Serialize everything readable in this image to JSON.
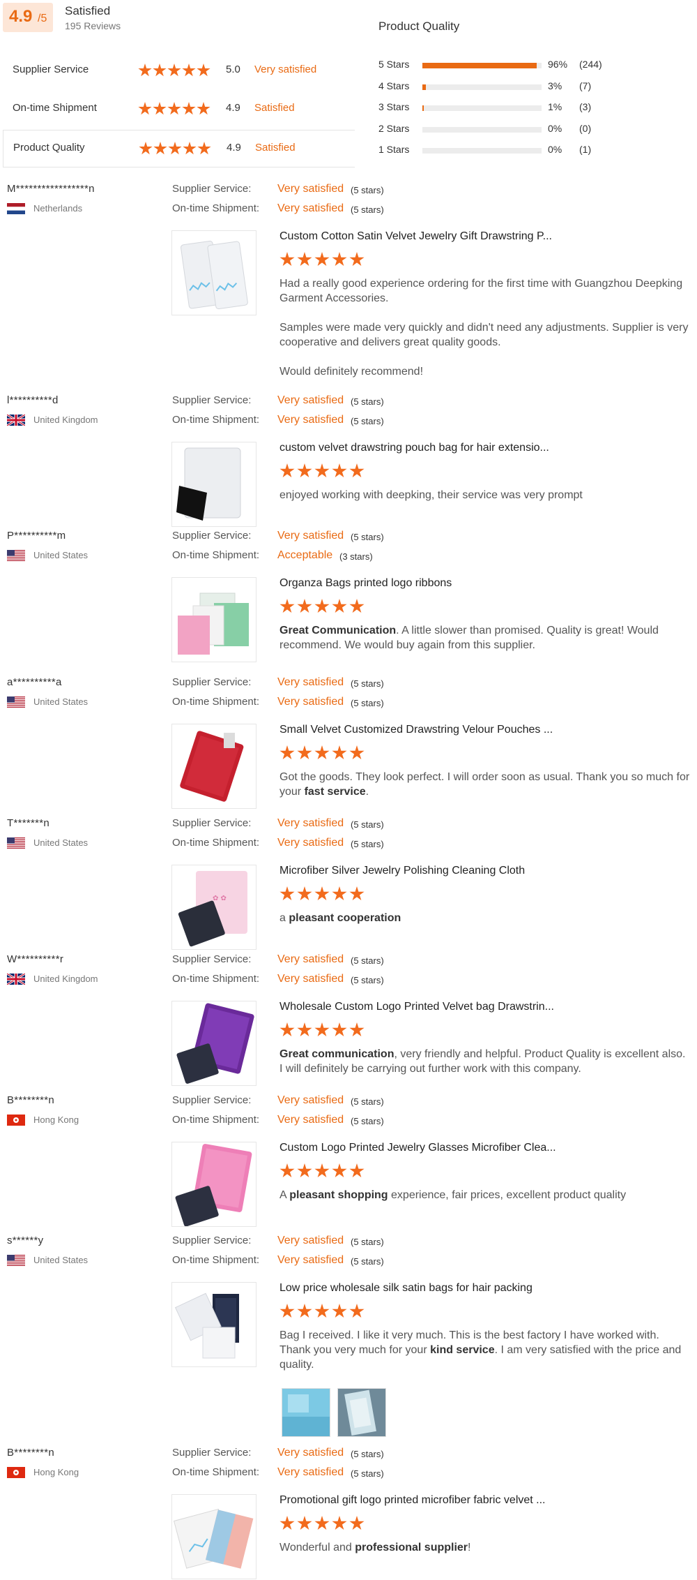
{
  "summary": {
    "score": "4.9",
    "score_max": "/5",
    "title": "Satisfied",
    "reviews": "195 Reviews",
    "rows": [
      {
        "label": "Supplier Service",
        "value": "5.0",
        "word": "Very satisfied"
      },
      {
        "label": "On-time Shipment",
        "value": "4.9",
        "word": "Satisfied"
      },
      {
        "label": "Product Quality",
        "value": "4.9",
        "word": "Satisfied"
      }
    ]
  },
  "product_quality": {
    "title": "Product Quality",
    "bars": [
      {
        "label": "5 Stars",
        "fraction": 0.96,
        "pct": "96%",
        "count": "(244)"
      },
      {
        "label": "4 Stars",
        "fraction": 0.03,
        "pct": "3%",
        "count": "(7)"
      },
      {
        "label": "3 Stars",
        "fraction": 0.01,
        "pct": "1%",
        "count": "(3)"
      },
      {
        "label": "2 Stars",
        "fraction": 0.0,
        "pct": "0%",
        "count": "(0)"
      },
      {
        "label": "1 Stars",
        "fraction": 0.0,
        "pct": "0%",
        "count": "(1)"
      }
    ]
  },
  "labels": {
    "supplier_service": "Supplier Service:",
    "ontime_shipment": "On-time Shipment:"
  },
  "reviews": [
    {
      "name": "M*****************n",
      "country": "Netherlands",
      "flag": "netherlands-flag-icon",
      "service": "Very satisfied",
      "service_stars": "(5 stars)",
      "shipment": "Very satisfied",
      "shipment_stars": "(5 stars)",
      "product": "Custom Cotton Satin Velvet Jewelry Gift Drawstring P...",
      "texts": [
        "Had a really good experience ordering for the first time with Guangzhou Deepking Garment Accessories.",
        "Samples were made very quickly and didn't need any adjustments. Supplier is very cooperative and delivers great quality goods.",
        "Would definitely recommend!"
      ]
    },
    {
      "name": "l**********d",
      "country": "United Kingdom",
      "flag": "uk-flag-icon",
      "service": "Very satisfied",
      "service_stars": "(5 stars)",
      "shipment": "Very satisfied",
      "shipment_stars": "(5 stars)",
      "product": "custom velvet drawstring pouch bag for hair extensio...",
      "texts": [
        "enjoyed working with deepking, their service was very prompt"
      ]
    },
    {
      "name": "P**********m",
      "country": "United States",
      "flag": "us-flag-icon",
      "service": "Very satisfied",
      "service_stars": "(5 stars)",
      "shipment": "Acceptable",
      "shipment_stars": "(3 stars)",
      "product": "Organza Bags printed logo ribbons",
      "text_bold": "Great Communication",
      "text_rest": ". A little slower than promised. Quality is great! Would recommend. We would buy again from this supplier."
    },
    {
      "name": "a**********a",
      "country": "United States",
      "flag": "us-flag-icon",
      "service": "Very satisfied",
      "service_stars": "(5 stars)",
      "shipment": "Very satisfied",
      "shipment_stars": "(5 stars)",
      "product": "Small Velvet Customized Drawstring Velour Pouches ...",
      "text_pre": "Got the goods. They look perfect. I will order soon as usual. Thank you so much for your ",
      "text_bold": "fast service",
      "text_post": "."
    },
    {
      "name": "T*******n",
      "country": "United States",
      "flag": "us-flag-icon",
      "service": "Very satisfied",
      "service_stars": "(5 stars)",
      "shipment": "Very satisfied",
      "shipment_stars": "(5 stars)",
      "product": "Microfiber Silver Jewelry Polishing Cleaning Cloth",
      "text_pre": "a ",
      "text_bold": "pleasant cooperation"
    },
    {
      "name": "W**********r",
      "country": "United Kingdom",
      "flag": "uk-flag-icon",
      "service": "Very satisfied",
      "service_stars": "(5 stars)",
      "shipment": "Very satisfied",
      "shipment_stars": "(5 stars)",
      "product": "Wholesale Custom Logo Printed Velvet bag Drawstrin...",
      "text_bold": "Great communication",
      "text_rest": ", very friendly and helpful.  Product Quality is excellent also. I will definitely be carrying out further work with this company."
    },
    {
      "name": "B********n",
      "country": "Hong Kong",
      "flag": "hk-flag-icon",
      "service": "Very satisfied",
      "service_stars": "(5 stars)",
      "shipment": "Very satisfied",
      "shipment_stars": "(5 stars)",
      "product": "Custom Logo Printed Jewelry Glasses Microfiber Clea...",
      "text_pre": "A ",
      "text_bold": "pleasant shopping",
      "text_post": " experience, fair prices, excellent product quality"
    },
    {
      "name": "s******y",
      "country": "United States",
      "flag": "us-flag-icon",
      "service": "Very satisfied",
      "service_stars": "(5 stars)",
      "shipment": "Very satisfied",
      "shipment_stars": "(5 stars)",
      "product": "Low price wholesale silk satin bags for hair packing",
      "text_pre": "Bag I received. I like it very much. This is the best factory I have worked with. Thank you very much for your ",
      "text_bold": "kind service",
      "text_post": ". I am very satisfied with the price and quality."
    },
    {
      "name": "B********n",
      "country": "Hong Kong",
      "flag": "hk-flag-icon",
      "service": "Very satisfied",
      "service_stars": "(5 stars)",
      "shipment": "Very satisfied",
      "shipment_stars": "(5 stars)",
      "product": "Promotional gift logo printed microfiber fabric velvet ...",
      "text_pre": "Wonderful and ",
      "text_bold": "professional supplier",
      "text_post": "!"
    }
  ],
  "colors": {
    "accent": "#e96a13",
    "score_bg": "#fde6d7",
    "bar_track": "#ececec"
  }
}
